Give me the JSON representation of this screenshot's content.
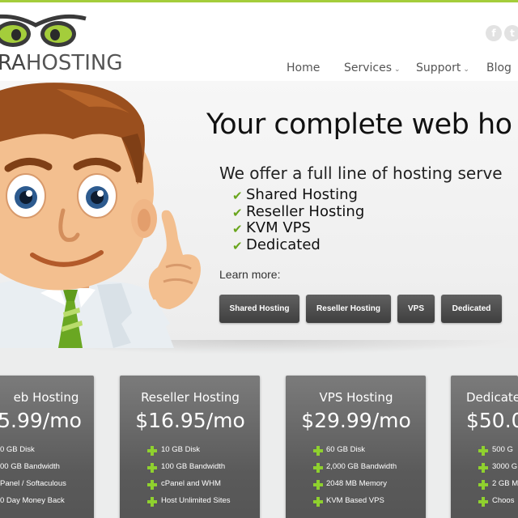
{
  "brand": {
    "logo_text_left": "RA",
    "logo_text_right": "HOSTING",
    "accent_color": "#a4cd3b",
    "icons": [
      "owl-eyes-logo"
    ]
  },
  "social": {
    "facebook_label": "f",
    "twitter_label": "t"
  },
  "nav": {
    "items": [
      {
        "label": "Home",
        "dropdown": false
      },
      {
        "label": "Services",
        "dropdown": true
      },
      {
        "label": "Support",
        "dropdown": true
      },
      {
        "label": "Blog",
        "dropdown": false
      }
    ],
    "chevron": "⌄"
  },
  "hero": {
    "headline": "Your complete web ho",
    "subheadline": "We offer a full line of hosting serve",
    "check_icon": "✔",
    "features": [
      "Shared Hosting",
      "Reseller Hosting",
      "KVM VPS",
      "Dedicated"
    ],
    "learn_more": "Learn more:",
    "buttons": [
      "Shared Hosting",
      "Reseller Hosting",
      "VPS",
      "Dedicated"
    ]
  },
  "plans": [
    {
      "title": "eb Hosting",
      "price": "5.99/mo",
      "features": [
        "0 GB Disk",
        "00 GB Bandwidth",
        "Panel / Softaculous",
        "0 Day Money Back"
      ]
    },
    {
      "title": "Reseller Hosting",
      "price": "$16.95/mo",
      "features": [
        "10 GB Disk",
        "100 GB Bandwidth",
        "cPanel and WHM",
        "Host Unlimited Sites"
      ]
    },
    {
      "title": "VPS Hosting",
      "price": "$29.99/mo",
      "features": [
        "60 GB Disk",
        "2,000 GB Bandwidth",
        "2048 MB Memory",
        "KVM Based VPS"
      ]
    },
    {
      "title": "Dedicate",
      "price": "$50.0",
      "features": [
        "500 G",
        "3000 G",
        "2 GB M",
        "Choos"
      ]
    }
  ]
}
